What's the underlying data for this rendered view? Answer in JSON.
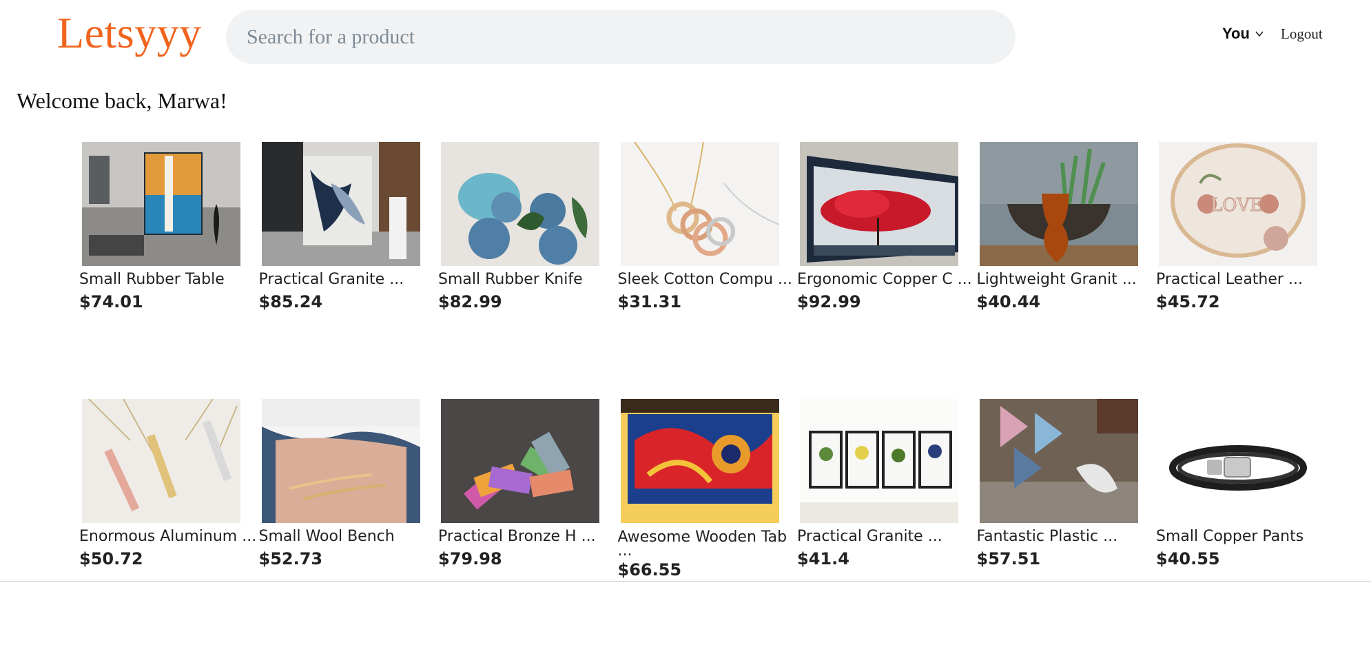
{
  "header": {
    "logo": "Letsyyy",
    "search_placeholder": "Search for a product",
    "user_menu_label": "You",
    "logout_label": "Logout"
  },
  "welcome": "Welcome back, Marwa!",
  "products": [
    {
      "title": "Small Rubber Table",
      "price": "$74.01",
      "image": "abstract-painting-living-room"
    },
    {
      "title": "Practical Granite ...",
      "price": "$85.24",
      "image": "abstract-painting-hallway"
    },
    {
      "title": "Small Rubber Knife",
      "price": "$82.99",
      "image": "blue-fabric-roses"
    },
    {
      "title": "Sleek Cotton Compu ...",
      "price": "$31.31",
      "image": "interlocking-ring-necklace"
    },
    {
      "title": "Ergonomic Copper C ...",
      "price": "$92.99",
      "image": "red-tree-canvas"
    },
    {
      "title": "Lightweight Granit ...",
      "price": "$40.44",
      "image": "tea-glass-with-plant"
    },
    {
      "title": "Practical Leather ...",
      "price": "$45.72",
      "image": "love-embroidery-hoop"
    },
    {
      "title": "Enormous Aluminum ...",
      "price": "$50.72",
      "image": "bar-pendant-necklaces"
    },
    {
      "title": "Small Wool Bench",
      "price": "$52.73",
      "image": "stacked-rings-on-hand"
    },
    {
      "title": "Practical Bronze H ...",
      "price": "$79.98",
      "image": "colorful-face-masks"
    },
    {
      "title": "Awesome Wooden Tab ...",
      "price": "$66.55",
      "image": "butterfly-painting"
    },
    {
      "title": "Practical Granite ...",
      "price": "$41.4",
      "image": "botanical-prints"
    },
    {
      "title": "Fantastic Plastic ...",
      "price": "$57.51",
      "image": "face-masks-on-table"
    },
    {
      "title": "Small Copper Pants",
      "price": "$40.55",
      "image": "leather-bead-bracelet"
    }
  ]
}
